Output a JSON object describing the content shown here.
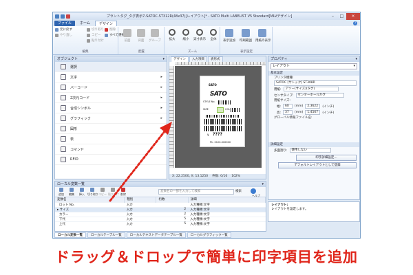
{
  "window": {
    "title": "プラントタグ_タグ表示7-SATOC-ST312R(48x37)[レイアウト]* - SATO Multi LABELIST V5 Standard[MLVデザイン]",
    "controls": [
      "–",
      "□",
      "×"
    ]
  },
  "menu": {
    "file": "ファイル",
    "home": "ホーム",
    "design": "デザイン"
  },
  "ribbon": {
    "edit": {
      "undo": "元に戻す",
      "redo": "やり直し",
      "cut": "切り取り",
      "copy": "コピー",
      "paste": "貼り付け",
      "delete": "削除",
      "select_all": "すべて選択",
      "label": "編集"
    },
    "arrange": {
      "front": "前面",
      "back": "背面",
      "group": "グループ",
      "label": "配置"
    },
    "zoom": {
      "zoom_in": "拡大",
      "zoom_out": "縮小",
      "fit": "実寸表示",
      "all": "全体",
      "label": "ズーム"
    },
    "display": {
      "preview": "表示追加",
      "grid": "印刷範囲",
      "print": "用紙の表示",
      "label": "表示設定"
    }
  },
  "objects": {
    "header": "オブジェクト",
    "items": [
      {
        "label": "選択",
        "icon": "cursor-icon",
        "arrow": ""
      },
      {
        "label": "文字",
        "icon": "text-icon",
        "arrow": "▸"
      },
      {
        "label": "バーコード",
        "icon": "barcode-icon",
        "arrow": "▸"
      },
      {
        "label": "2次元コード",
        "icon": "qrcode-icon",
        "arrow": "▸"
      },
      {
        "label": "合成シンボル",
        "icon": "symbol-icon",
        "arrow": "▸"
      },
      {
        "label": "グラフィック",
        "icon": "graphic-icon",
        "arrow": "▸"
      },
      {
        "label": "図形",
        "icon": "shape-icon",
        "arrow": "▸"
      },
      {
        "label": "表",
        "icon": "table-icon",
        "arrow": ""
      },
      {
        "label": "コマンド",
        "icon": "command-icon",
        "arrow": ""
      },
      {
        "label": "RFID",
        "icon": "rfid-icon",
        "arrow": ""
      }
    ]
  },
  "design": {
    "tabs": [
      "デザイン",
      "入力項目",
      "表形式"
    ],
    "label_texts": {
      "sato_small": "SATO",
      "sato_logo": "SATO",
      "style_line": "STYLE No.",
      "color_line": "COL",
      "size_line": "SIZE",
      "price_symbol": "¥",
      "price": "????",
      "footer": "Ph. 0120-000000"
    },
    "status": {
      "coords": "X: 22.2500, X: 13.1250",
      "pos": "件数: 0/16",
      "zoom": "102%"
    }
  },
  "bottom": {
    "header": "ローカル変数一覧",
    "toolbar": [
      {
        "label": "追加",
        "dim": false
      },
      {
        "label": "編集",
        "dim": false
      },
      {
        "label": "挿入",
        "dim": false
      },
      {
        "label": "切り取り",
        "dim": false
      },
      {
        "label": "コピー",
        "dim": true
      },
      {
        "label": "貼り付け",
        "dim": true
      },
      {
        "label": "削除",
        "dim": false
      }
    ],
    "search_placeholder": "変数名の一部を入力して検索",
    "search_button": "検索",
    "help_label": "ヘルプ",
    "columns": [
      "変数名",
      "種別",
      "桁数",
      "詳細"
    ],
    "rows": [
      {
        "name": "ロット No.",
        "kind": "入力",
        "digits": "",
        "detail": "入力種類:文字",
        "selected": false
      },
      {
        "name": "サイズ",
        "kind": "入力",
        "digits": "2",
        "detail": "入力種類:文字",
        "selected": true
      },
      {
        "name": "カラー",
        "kind": "入力",
        "digits": "2",
        "detail": "入力種類:文字",
        "selected": false
      },
      {
        "name": "下代",
        "kind": "入力",
        "digits": "5",
        "detail": "入力種類:文字",
        "selected": false
      },
      {
        "name": "上代",
        "kind": "入力",
        "digits": "5",
        "detail": "入力種類:文字",
        "selected": false
      }
    ],
    "tabs": [
      "ローカル変数一覧",
      "ローカルテーブル一覧",
      "ローカルテキストデータテーブル一覧",
      "ローカルグラフィック一覧"
    ]
  },
  "properties": {
    "header": "プロパティ",
    "selector": "レイアウト",
    "section_basic": "基本設定",
    "printer_label": "プリンタ機種:",
    "printer_value": "SATOC [サトック] ST308R",
    "paper_label": "用紙:",
    "paper_value": "アソー(サイズ)(タグ)",
    "sensor_label": "センサタイプ:",
    "sensor_value": "センターホールかぎ",
    "size_label": "用紙サイズ:",
    "width": {
      "label": "幅:",
      "value": "60",
      "unit1": "(mm)",
      "inch": "2.3622",
      "unit2": "(インチ)"
    },
    "height": {
      "label": "高:",
      "value": "37",
      "unit1": "(mm)",
      "inch": "1.4567",
      "unit2": "(インチ)"
    },
    "global_file": "グローバル情報ファイル名:",
    "section_detail": "詳細設定",
    "multi_label": "多面割り:",
    "multi_value": "使用しない",
    "btn_detail": "印字詳細設定...",
    "btn_default": "デフォルトレイアウトとして登録",
    "desc_title": "レイアウト:",
    "desc_text": "レイアウトを設定します。"
  },
  "caption": "ドラッグ＆ドロップで簡単に印字項目を追加",
  "colors": {
    "accent": "#2f65b0",
    "caption": "#e0261b",
    "arrow": "#e0261b",
    "highlight": "#8bc34a"
  }
}
